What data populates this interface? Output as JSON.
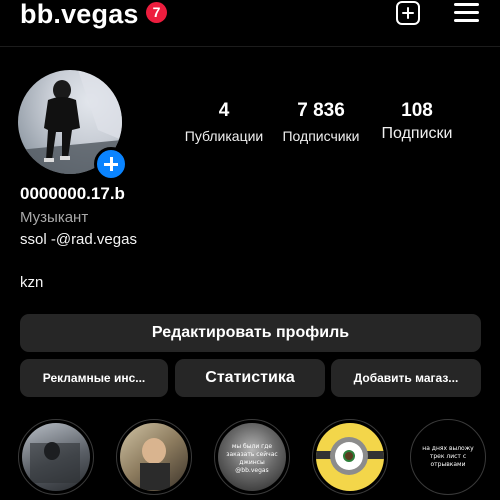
{
  "header": {
    "username": "bb.vegas",
    "notification_count": "7",
    "add_icon": "plus-square-icon",
    "menu_icon": "hamburger-menu-icon"
  },
  "profile": {
    "avatar_icon": "avatar-photo",
    "avatar_add_icon": "plus-icon",
    "stats": {
      "posts": {
        "value": "4",
        "label": "Публикации"
      },
      "followers": {
        "value": "7 836",
        "label": "Подписчики"
      },
      "following": {
        "value": "108",
        "label": "Подписки"
      }
    },
    "display_name": "0000000.17.b",
    "category": "Музыкант",
    "bio_line": "ssol -@rad.vegas",
    "location": "kzn"
  },
  "buttons": {
    "edit_profile": "Редактировать профиль",
    "ads_tools": "Рекламные инс...",
    "statistics": "Статистика",
    "add_shop": "Добавить магаз..."
  },
  "highlights": [
    {
      "text": ""
    },
    {
      "text": ""
    },
    {
      "text": "мы были где заказать сейчас джинсы @bb.vegas"
    },
    {
      "text": ""
    },
    {
      "text": "на днях выложу трек лист с отрывками"
    }
  ],
  "colors": {
    "background": "#000000",
    "button_bg": "#262626",
    "badge": "#ed1d3e",
    "accent_blue": "#0a84ff",
    "secondary_text": "#a8a8a8"
  }
}
